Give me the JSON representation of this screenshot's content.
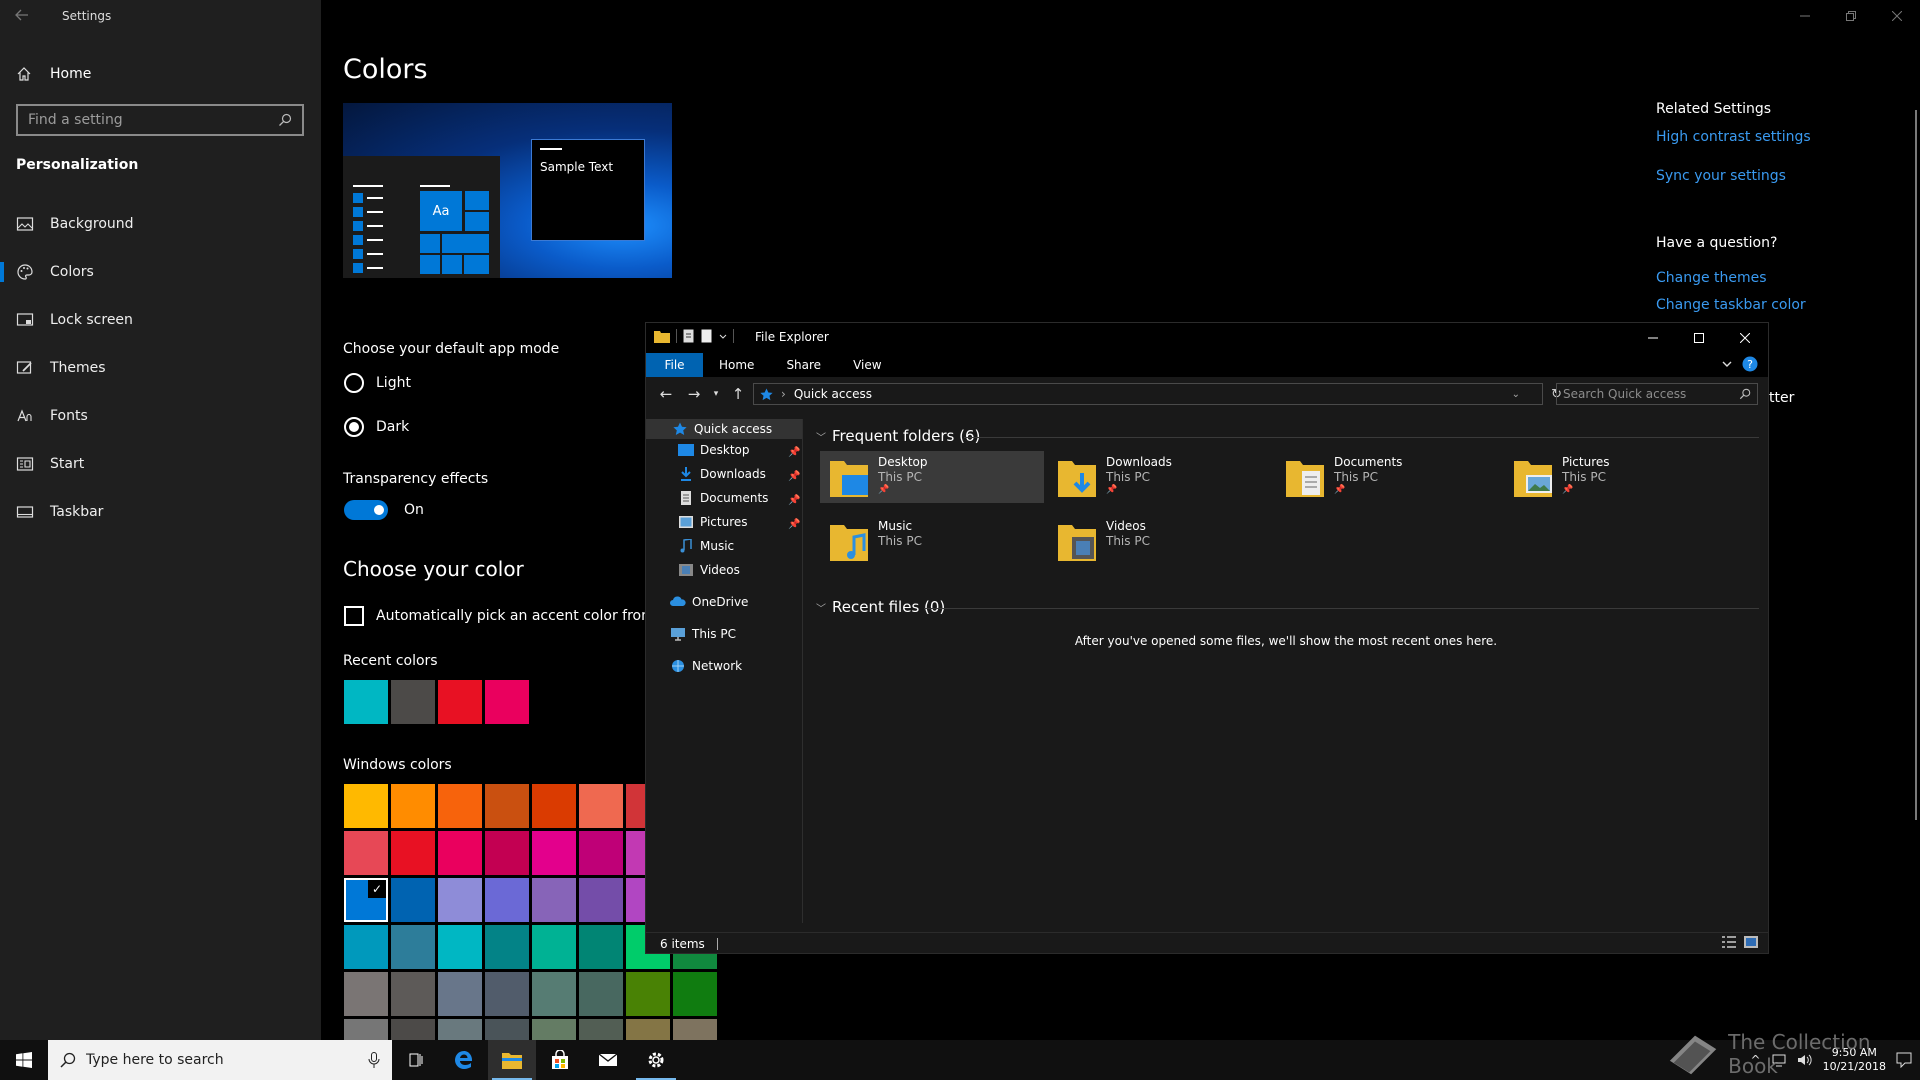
{
  "settings": {
    "app_title": "Settings",
    "home_label": "Home",
    "search_placeholder": "Find a setting",
    "section": "Personalization",
    "nav": [
      {
        "label": "Background",
        "icon": "picture-icon"
      },
      {
        "label": "Colors",
        "icon": "palette-icon",
        "selected": true
      },
      {
        "label": "Lock screen",
        "icon": "lock-screen-icon"
      },
      {
        "label": "Themes",
        "icon": "brush-icon"
      },
      {
        "label": "Fonts",
        "icon": "font-icon"
      },
      {
        "label": "Start",
        "icon": "start-icon"
      },
      {
        "label": "Taskbar",
        "icon": "taskbar-icon"
      }
    ]
  },
  "colors_page": {
    "title": "Colors",
    "preview_sample_text": "Sample Text",
    "preview_tile_text": "Aa",
    "app_mode_label": "Choose your default app mode",
    "mode_light": "Light",
    "mode_dark": "Dark",
    "selected_mode": "Dark",
    "transparency_label": "Transparency effects",
    "transparency_state": "On",
    "choose_color_title": "Choose your color",
    "auto_pick_label": "Automatically pick an accent color from my b",
    "recent_colors_label": "Recent colors",
    "recent_colors": [
      "#00b7c3",
      "#4c4a48",
      "#e81123",
      "#ea005e"
    ],
    "windows_colors_label": "Windows colors",
    "windows_colors": [
      [
        "#ffb900",
        "#ff8c00",
        "#f7630c",
        "#ca5010",
        "#da3b01",
        "#ef6950",
        "#d13438"
      ],
      [
        "#e74856",
        "#e81123",
        "#ea005e",
        "#c30052",
        "#e3008c",
        "#bf0077",
        "#c239b3"
      ],
      [
        "#0078d7",
        "#0063b1",
        "#8e8cd8",
        "#6b69d6",
        "#8764b8",
        "#744da9",
        "#b146c2"
      ],
      [
        "#0099bc",
        "#2d7d9a",
        "#00b7c3",
        "#038387",
        "#00b294",
        "#018574",
        "#00cc6a",
        "#10893e"
      ],
      [
        "#7a7574",
        "#5d5a58",
        "#68768a",
        "#515c6b",
        "#567c73",
        "#486860",
        "#498205",
        "#107c10"
      ],
      [
        "#767676",
        "#4c4a48",
        "#69797e",
        "#4a5459",
        "#647c64",
        "#525e54",
        "#847545",
        "#7e735f"
      ]
    ],
    "selected_color": "#0078d7",
    "partial_text": "tter"
  },
  "related": {
    "title": "Related Settings",
    "links": [
      "High contrast settings",
      "Sync your settings"
    ],
    "question_title": "Have a question?",
    "question_links": [
      "Change themes",
      "Change taskbar color"
    ]
  },
  "explorer": {
    "title": "File Explorer",
    "ribbon_tabs": [
      "File",
      "Home",
      "Share",
      "View"
    ],
    "address": "Quick access",
    "search_placeholder": "Search Quick access",
    "nav": [
      {
        "label": "Quick access",
        "icon": "star-icon"
      },
      {
        "label": "Desktop",
        "icon": "desktop-folder-icon",
        "pinned": true
      },
      {
        "label": "Downloads",
        "icon": "downloads-arrow-icon",
        "pinned": true
      },
      {
        "label": "Documents",
        "icon": "document-icon",
        "pinned": true
      },
      {
        "label": "Pictures",
        "icon": "pictures-icon",
        "pinned": true
      },
      {
        "label": "Music",
        "icon": "music-icon"
      },
      {
        "label": "Videos",
        "icon": "video-icon"
      },
      {
        "label": "OneDrive",
        "icon": "cloud-icon"
      },
      {
        "label": "This PC",
        "icon": "computer-icon"
      },
      {
        "label": "Network",
        "icon": "network-icon"
      }
    ],
    "frequent_header": "Frequent folders (6)",
    "frequent": [
      {
        "name": "Desktop",
        "location": "This PC",
        "pinned": true,
        "selected": true,
        "icon": "desktop-folder-icon"
      },
      {
        "name": "Downloads",
        "location": "This PC",
        "pinned": true,
        "icon": "downloads-folder-icon"
      },
      {
        "name": "Documents",
        "location": "This PC",
        "pinned": true,
        "icon": "documents-folder-icon"
      },
      {
        "name": "Pictures",
        "location": "This PC",
        "pinned": true,
        "icon": "pictures-folder-icon"
      },
      {
        "name": "Music",
        "location": "This PC",
        "pinned": false,
        "icon": "music-folder-icon"
      },
      {
        "name": "Videos",
        "location": "This PC",
        "pinned": false,
        "icon": "videos-folder-icon"
      }
    ],
    "recent_header": "Recent files (0)",
    "recent_empty": "After you've opened some files, we'll show the most recent ones here.",
    "status": "6 items"
  },
  "taskbar": {
    "search_placeholder": "Type here to search",
    "time": "9:50 AM",
    "date": "10/21/2018",
    "apps": [
      "task-view-icon",
      "edge-icon",
      "file-explorer-icon",
      "store-icon",
      "mail-icon",
      "settings-gear-icon"
    ]
  },
  "watermark": "The Collection Book"
}
